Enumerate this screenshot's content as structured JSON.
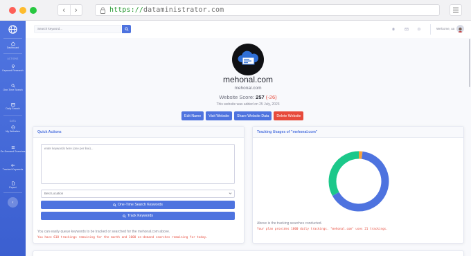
{
  "browser": {
    "url_scheme": "https://",
    "url_host": "dataministrator.com",
    "back_glyph": "‹",
    "forward_glyph": "›"
  },
  "sidebar": {
    "brand_icon": "globe-icon",
    "sections": {
      "actions": "ACTIONS",
      "data": "DATA"
    },
    "items": [
      {
        "label": "Dashboard",
        "icon": "home-icon"
      },
      {
        "label": "Keyword Research",
        "icon": "lightbulb-icon"
      },
      {
        "label": "One-Time Search",
        "icon": "search-icon"
      },
      {
        "label": "Daily Search",
        "icon": "calendar-icon"
      },
      {
        "label": "My Websites",
        "icon": "globe-icon"
      },
      {
        "label": "On-Demand Searches",
        "icon": "list-icon"
      },
      {
        "label": "Tracked Keywords",
        "icon": "key-icon"
      },
      {
        "label": "Export",
        "icon": "file-icon"
      }
    ],
    "toggle_glyph": "‹"
  },
  "topbar": {
    "search_placeholder": "Search keyword...",
    "welcome": "Welcome, ua"
  },
  "site": {
    "domain": "mehonal.com",
    "domain_sub": "mehonal.com",
    "score_label": "Website Score:",
    "score": "257",
    "score_change": "(-26)",
    "added_text": "This website was added on 25 July, 2023",
    "buttons": {
      "edit": "Edit Name",
      "visit": "Visit Website",
      "share": "Share Website Data",
      "delete": "Delete Website"
    }
  },
  "quick_actions": {
    "title": "Quick Actions",
    "textarea_placeholder": "enter keywords here (one per line)...",
    "location_selected": "Best Location",
    "one_time_button": "One-Time Search Keywords",
    "track_button": "Track Keywords",
    "note": "You can easily queue keywords to be tracked or searched for the mehonal.com above.",
    "remaining": "You have 618 trackings remaining for the month and 1000 on-demand searches remaining for today."
  },
  "tracking_usage": {
    "title": "Tracking Usages of \"mehonal.com\"",
    "note": "Above is the tracking searches conducted.",
    "plan_text": "Your plan provides 1000 daily trackings. \"mehonal.com\" uses 21 trackings.",
    "colors": {
      "blue": "#4e73df",
      "green": "#1cc88a",
      "orange": "#f6a23e"
    }
  },
  "chart_data": {
    "type": "pie",
    "variant": "donut",
    "values": [
      65,
      33,
      2
    ],
    "colors": [
      "#4e73df",
      "#1cc88a",
      "#f6a23e"
    ]
  }
}
